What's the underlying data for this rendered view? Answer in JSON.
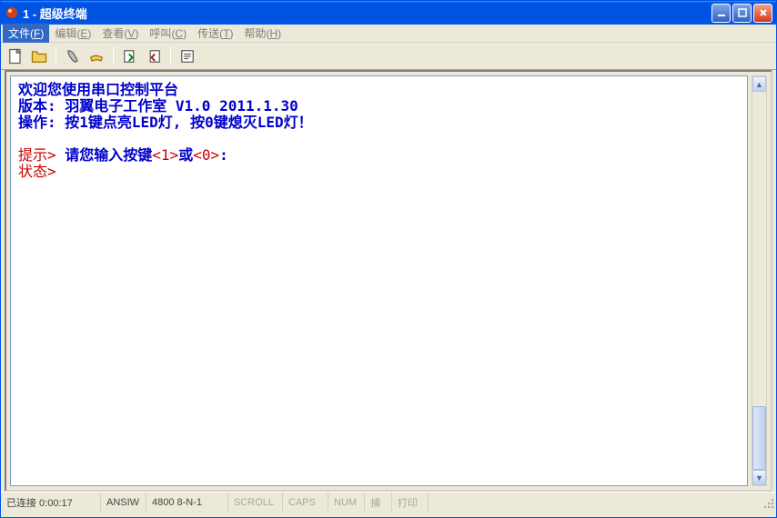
{
  "window": {
    "title": "1 - 超级终端"
  },
  "menu": {
    "file": {
      "label": "文件",
      "hotkey": "F"
    },
    "edit": {
      "label": "编辑",
      "hotkey": "E"
    },
    "view": {
      "label": "查看",
      "hotkey": "V"
    },
    "call": {
      "label": "呼叫",
      "hotkey": "C"
    },
    "transfer": {
      "label": "传送",
      "hotkey": "T"
    },
    "help": {
      "label": "帮助",
      "hotkey": "H"
    }
  },
  "toolbar": {
    "new": "new-file-icon",
    "open": "open-folder-icon",
    "connect": "phone-connect-icon",
    "disconnect": "phone-disconnect-icon",
    "send": "send-file-icon",
    "receive": "receive-file-icon",
    "properties": "properties-icon"
  },
  "terminal": {
    "line1": "欢迎您使用串口控制平台",
    "line2": "版本: 羽翼电子工作室 V1.0 2011.1.30",
    "line3": "操作: 按1键点亮LED灯, 按0键熄灭LED灯！",
    "prompt_tip_label": "提示>",
    "prompt_tip_text_a": " 请您输入按键",
    "prompt_tip_key1": "<1>",
    "prompt_tip_text_b": "或",
    "prompt_tip_key0": "<0>",
    "prompt_tip_text_c": ":",
    "prompt_status_label": "状态>"
  },
  "status": {
    "connected": "已连接 0:00:17",
    "emulation": "ANSIW",
    "port_settings": "4800 8-N-1",
    "scroll": "SCROLL",
    "caps": "CAPS",
    "num": "NUM",
    "capture": "捕",
    "print": "打印"
  }
}
